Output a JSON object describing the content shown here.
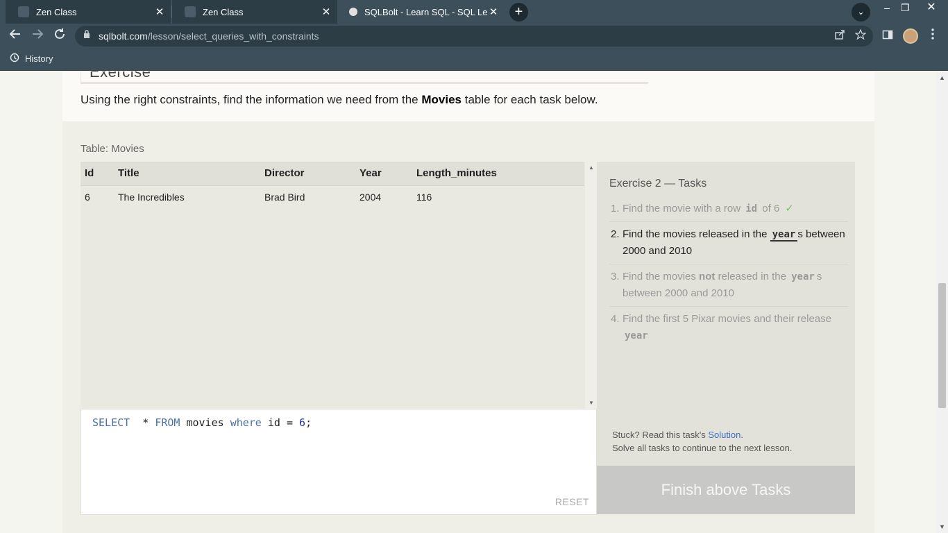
{
  "browser": {
    "tabs": [
      {
        "title": "Zen Class",
        "state": "inactive"
      },
      {
        "title": "Zen Class",
        "state": "inactive"
      },
      {
        "title": "SQLBolt - Learn SQL - SQL Lesson",
        "state": "active"
      }
    ],
    "tab_close_glyph": "✕",
    "new_tab_glyph": "+",
    "tab_search_glyph": "⌄",
    "window_controls": {
      "minimize": "–",
      "restore": "❐",
      "close": "✕"
    },
    "url": {
      "host": "sqlbolt.com",
      "path": "/lesson/select_queries_with_constraints"
    },
    "bookmarks": [
      {
        "label": "History",
        "icon": "history-icon"
      }
    ],
    "colors": {
      "chrome": "#3c4f5a",
      "inactive_tab": "#2c3d46",
      "omnibox": "#2c3d46"
    }
  },
  "page": {
    "exercise_heading": "Exercise",
    "intro": {
      "before": "Using the right constraints, find the information we need from the ",
      "bold": "Movies",
      "after": " table for each task below."
    },
    "table_caption": "Table: Movies",
    "results": {
      "columns": [
        "Id",
        "Title",
        "Director",
        "Year",
        "Length_minutes"
      ],
      "rows": [
        [
          "6",
          "The Incredibles",
          "Brad Bird",
          "2004",
          "116"
        ]
      ]
    },
    "editor": {
      "code": {
        "kw1": "SELECT",
        "t1": "  * ",
        "kw2": "FROM",
        "t2": " movies ",
        "kw3": "where",
        "t3": " id = ",
        "num": "6",
        "t4": ";"
      },
      "reset_label": "RESET"
    },
    "tasks": {
      "title": "Exercise 2 — Tasks",
      "items": [
        {
          "num": "1.",
          "state": "done",
          "a": "Find the movie with a row ",
          "code": "id",
          "b": " of 6",
          "check": "✓"
        },
        {
          "num": "2.",
          "state": "current",
          "a": "Find the movies released in the ",
          "code": "year",
          "b": "s between 2000 and 2010"
        },
        {
          "num": "3.",
          "state": "pending",
          "a": "Find the movies ",
          "bold": "not",
          "c": " released in the ",
          "code": "year",
          "b": "s between 2000 and 2010"
        },
        {
          "num": "4.",
          "state": "pending",
          "a": "Find the first 5 Pixar movies and their release ",
          "code": "year"
        }
      ],
      "help_prefix": "Stuck? Read this task's ",
      "help_link": "Solution",
      "help_suffix": ".",
      "help_line2": "Solve all tasks to continue to the next lesson."
    },
    "finish_label": "Finish above Tasks",
    "colors": {
      "accent_link": "#3a6fc4",
      "check": "#7cbf6a",
      "finish_bg": "#c8c8c6"
    }
  }
}
